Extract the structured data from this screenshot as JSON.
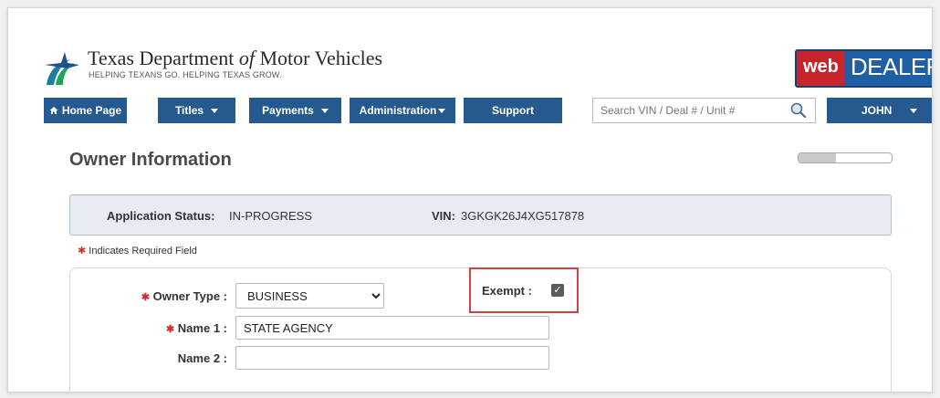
{
  "header": {
    "brand_title_a": "Texas Department ",
    "brand_title_of": "of",
    "brand_title_b": " Motor Vehicles",
    "brand_tagline": "HELPING TEXANS GO. HELPING TEXAS GROW.",
    "webdealer_web": "web",
    "webdealer_dealer": "DEALER"
  },
  "nav": {
    "home_icon": "home-icon",
    "home_label": "Home Page",
    "titles_label": "Titles",
    "payments_label": "Payments",
    "administration_label": "Administration",
    "support_label": "Support",
    "search_placeholder": "Search VIN / Deal # / Unit #",
    "search_icon": "search-icon",
    "user_label": "JOHN"
  },
  "page": {
    "title": "Owner Information",
    "progress_fraction": 0.4
  },
  "status": {
    "app_status_label": "Application Status:",
    "app_status_value": "IN-PROGRESS",
    "vin_label": "VIN:",
    "vin_value": "3GKGK26J4XG517878"
  },
  "required_note": "Indicates Required Field",
  "form": {
    "owner_type_label": "Owner Type :",
    "owner_type_value": "BUSINESS",
    "exempt_label": "Exempt :",
    "exempt_checked": true,
    "name1_label": "Name 1 :",
    "name1_value": "STATE AGENCY",
    "name2_label": "Name 2 :",
    "name2_value": ""
  },
  "colors": {
    "nav_blue": "#265a8f",
    "required_red": "#d0312d",
    "highlight_red": "#d64045",
    "status_bg": "#e6ecf1"
  }
}
